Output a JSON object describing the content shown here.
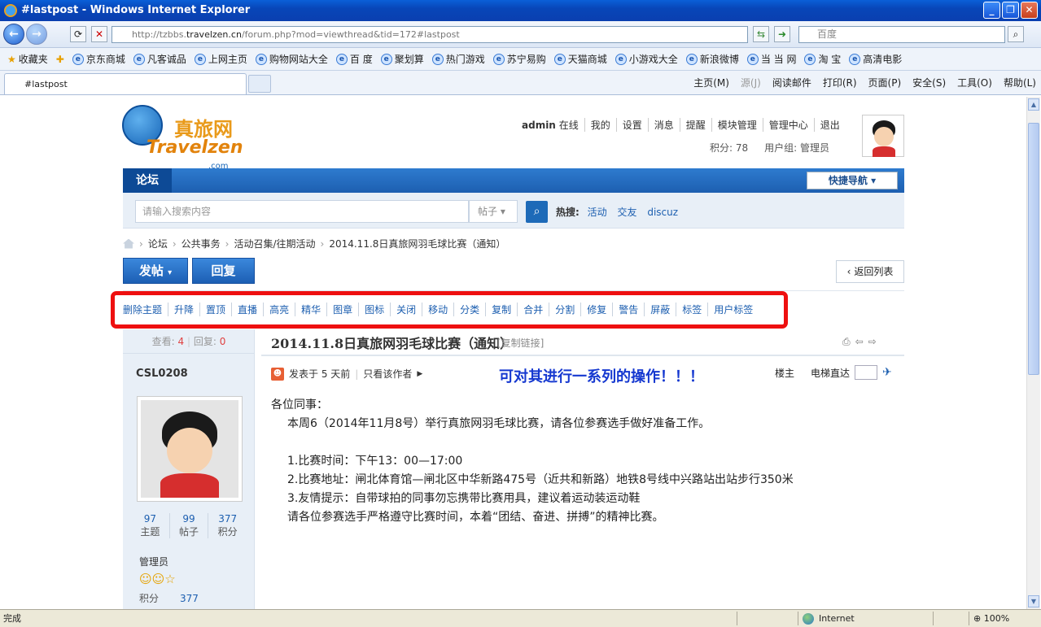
{
  "window": {
    "title": "#lastpost - Windows Internet Explorer",
    "url_prefix": "http://tzbbs.",
    "url_domain": "travelzen.cn",
    "url_path": "/forum.php?mod=viewthread&tid=172#lastpost",
    "search_placeholder": "百度",
    "tab_title": "#lastpost"
  },
  "favorites": {
    "label": "收藏夹",
    "items": [
      "京东商城",
      "凡客诚品",
      "上网主页",
      "购物网站大全",
      "百 度",
      "聚划算",
      "热门游戏",
      "苏宁易购",
      "天猫商城",
      "小游戏大全",
      "新浪微博",
      "当 当 网",
      "淘 宝",
      "高清电影"
    ]
  },
  "commandbar": [
    "主页(M)",
    "源(J)",
    "阅读邮件",
    "打印(R)",
    "页面(P)",
    "安全(S)",
    "工具(O)",
    "帮助(L)"
  ],
  "site": {
    "logo_cn": "真旅网",
    "logo_en": "Travelzen",
    "logo_com": ".com",
    "user": {
      "name": "admin",
      "online": "在线",
      "links": [
        "我的",
        "设置",
        "消息",
        "提醒",
        "模块管理",
        "管理中心",
        "退出"
      ],
      "score": "积分: 78",
      "group": "用户组: 管理员"
    },
    "nav": {
      "forum_tab": "论坛",
      "quick_nav": "快捷导航"
    },
    "search": {
      "placeholder": "请输入搜索内容",
      "type": "帖子",
      "hot_label": "热搜:",
      "hot": [
        "活动",
        "交友",
        "discuz"
      ]
    },
    "breadcrumb": [
      "论坛",
      "公共事务",
      "活动召集/往期活动",
      "2014.11.8日真旅网羽毛球比赛（通知）"
    ],
    "buttons": {
      "post": "发帖",
      "reply": "回复",
      "back": "返回列表"
    },
    "modbar": [
      "删除主题",
      "升降",
      "置顶",
      "直播",
      "高亮",
      "精华",
      "图章",
      "图标",
      "关闭",
      "移动",
      "分类",
      "复制",
      "合并",
      "分割",
      "修复",
      "警告",
      "屏蔽",
      "标签",
      "用户标签"
    ],
    "thread": {
      "views_label": "查看:",
      "views": "4",
      "replies_label": "回复:",
      "replies": "0",
      "title": "2014.11.8日真旅网羽毛球比赛（通知）",
      "copy_link": "[复制链接]"
    },
    "author": {
      "name": "CSL0208",
      "stats": [
        {
          "n": "97",
          "l": "主题"
        },
        {
          "n": "99",
          "l": "帖子"
        },
        {
          "n": "377",
          "l": "积分"
        }
      ],
      "role": "管理员",
      "score_label": "积分",
      "score": "377"
    },
    "post": {
      "posted": "发表于 5 天前",
      "only_author": "只看该作者",
      "annotation": "可对其进行一系列的操作！！！",
      "floor": "楼主",
      "elevator": "电梯直达",
      "greeting": "各位同事：",
      "lines": [
        "本周6（2014年11月8号）举行真旅网羽毛球比赛，请各位参赛选手做好准备工作。",
        "1.比赛时间：下午13：00—17:00",
        "2.比赛地址：闸北体育馆—闸北区中华新路475号（近共和新路）地铁8号线中兴路站出站步行350米",
        "3.友情提示：自带球拍的同事勿忘携带比赛用具，建议着运动装运动鞋",
        "请各位参赛选手严格遵守比赛时间，本着“团结、奋进、拼搏”的精神比赛。"
      ]
    }
  },
  "statusbar": {
    "text": "完成",
    "zone": "Internet",
    "zoom": "100%"
  }
}
